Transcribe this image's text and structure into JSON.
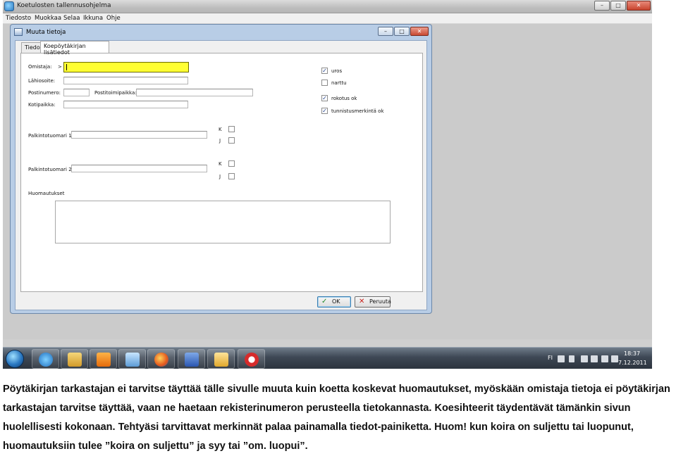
{
  "app": {
    "title": "Koetulosten tallennusohjelma",
    "window_controls": [
      "–",
      "□",
      "✕"
    ]
  },
  "menubar": {
    "items": [
      "Tiedosto",
      "Muokkaa",
      "Selaa",
      "Ikkuna",
      "Ohje"
    ]
  },
  "child_window": {
    "title": "Muuta tietoja",
    "tabs": [
      "Tiedot",
      "Koepöytäkirjan lisätiedot"
    ],
    "fields": {
      "omistaja_label": "Omistaja:",
      "omistaja_marker": ">",
      "lahiosoite_label": "Lähiosoite:",
      "postinumero_label": "Postinumero:",
      "postitoimipaikka_label": "Postitoimipaikka:",
      "kotipaikka_label": "Kotipaikka:",
      "palkintotuomari1_label": "Palkintotuomari 1:",
      "palkintotuomari2_label": "Palkintotuomari 2:",
      "huomautukset_label": "Huomautukset"
    },
    "judge_checks": {
      "k_label": "K",
      "j_label": "J"
    },
    "checkboxes": [
      {
        "label": "uros",
        "checked": true
      },
      {
        "label": "narttu",
        "checked": false
      },
      {
        "label": "rokotus ok",
        "checked": true
      },
      {
        "label": "tunnistusmerkintä ok",
        "checked": true
      }
    ],
    "buttons": {
      "ok": "OK",
      "cancel": "Peruuta"
    }
  },
  "taskbar": {
    "lang": "FI",
    "time": "18:37",
    "date": "7.12.2011"
  },
  "description": "Pöytäkirjan tarkastajan ei tarvitse täyttää tälle sivulle muuta kuin koetta koskevat huomautukset, myöskään omistaja tietoja ei pöytäkirjan tarkastajan tarvitse täyttää, vaan ne haetaan rekisterinumeron perusteella tietokannasta. Koesihteerit täydentävät tämänkin sivun huolellisesti kokonaan. Tehtyäsi tarvittavat merkinnät palaa painamalla tiedot-painiketta. Huom! kun koira on suljettu tai luopunut, huomautuksiin tulee ”koira on suljettu” ja syy tai ”om. luopui”."
}
